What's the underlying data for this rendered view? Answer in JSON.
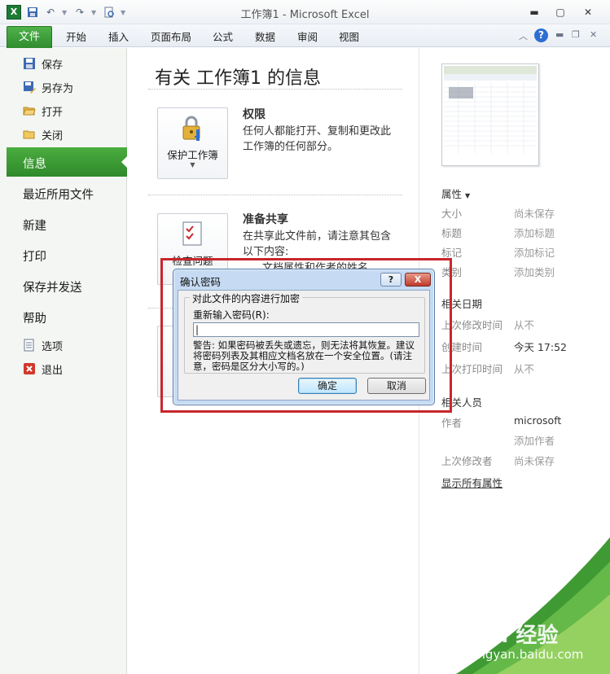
{
  "window": {
    "title": "工作簿1 - Microsoft Excel",
    "app_icon_letter": "X",
    "controls": [
      "minimize-icon",
      "maximize-icon",
      "close-icon"
    ]
  },
  "ribbon": {
    "file_tab": "文件",
    "tabs": [
      "开始",
      "插入",
      "页面布局",
      "公式",
      "数据",
      "审阅",
      "视图"
    ]
  },
  "nav": {
    "small_top": [
      {
        "label": "保存",
        "icon": "save-icon"
      },
      {
        "label": "另存为",
        "icon": "save-as-icon"
      },
      {
        "label": "打开",
        "icon": "open-folder-icon"
      },
      {
        "label": "关闭",
        "icon": "close-folder-icon"
      }
    ],
    "large": [
      "信息",
      "最近所用文件",
      "新建",
      "打印",
      "保存并发送",
      "帮助"
    ],
    "selected": "信息",
    "small_bottom": [
      {
        "label": "选项",
        "icon": "options-icon"
      },
      {
        "label": "退出",
        "icon": "exit-icon"
      }
    ]
  },
  "info": {
    "title": "有关 工作簿1 的信息",
    "permissions": {
      "button": "保护工作簿",
      "title": "权限",
      "desc_line1": "任何人都能打开、复制和更改此",
      "desc_line2": "工作簿的任何部分。"
    },
    "share": {
      "button": "检查问题",
      "title": "准备共享",
      "desc_line1": "在共享此文件前，请注意其包含",
      "desc_line2": "以下内容:",
      "bullet": "文档属性和作者的姓名"
    }
  },
  "properties": {
    "header": "属性",
    "rows": [
      {
        "key": "大小",
        "value": "尚未保存"
      },
      {
        "key": "标题",
        "value": "添加标题"
      },
      {
        "key": "标记",
        "value": "添加标记"
      },
      {
        "key": "类别",
        "value": "添加类别"
      }
    ],
    "dates_header": "相关日期",
    "dates": [
      {
        "key": "上次修改时间",
        "value": "从不"
      },
      {
        "key": "创建时间",
        "value": "今天 17:52"
      },
      {
        "key": "上次打印时间",
        "value": "从不"
      }
    ],
    "people_header": "相关人员",
    "author_key": "作者",
    "author_value": "microsoft",
    "add_author": "添加作者",
    "last_modified_by_key": "上次修改者",
    "last_modified_by_value": "尚未保存",
    "show_all": "显示所有属性"
  },
  "dialog": {
    "title": "确认密码",
    "help": "?",
    "close": "X",
    "group_title": "对此文件的内容进行加密",
    "reenter_label": "重新输入密码(R):",
    "password_value": "",
    "warning": "警告: 如果密码被丢失或遗忘，则无法将其恢复。建议将密码列表及其相应文档名放在一个安全位置。(请注意，密码是区分大小写的。)",
    "ok": "确定",
    "cancel": "取消"
  },
  "watermark": {
    "brand": "Bai 经验",
    "url": "jingyan.baidu.com"
  },
  "colors": {
    "accent_green": "#2f8b2b",
    "highlight_red": "#c8262c",
    "dialog_blue": "#c6dbf3"
  }
}
